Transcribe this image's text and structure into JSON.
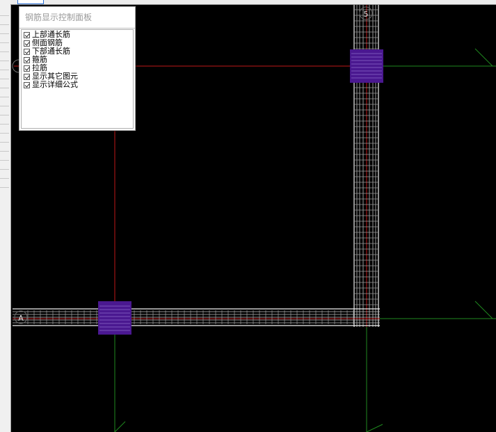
{
  "panel": {
    "title": "钢筋显示控制面板",
    "options": [
      {
        "label": "上部通长筋",
        "checked": true
      },
      {
        "label": "侧面钢筋",
        "checked": true
      },
      {
        "label": "下部通长筋",
        "checked": true
      },
      {
        "label": "箍筋",
        "checked": true
      },
      {
        "label": "拉筋",
        "checked": true
      },
      {
        "label": "显示其它图元",
        "checked": true
      },
      {
        "label": "显示详细公式",
        "checked": true
      }
    ]
  },
  "axes": {
    "vertical_label": "5",
    "horizontal_label": "A"
  },
  "colors": {
    "background": "#000000",
    "axis_line": "#c01818",
    "grid_line": "#1f8a1f",
    "column": "#4a1890",
    "rebar": "#e6e6e6"
  }
}
